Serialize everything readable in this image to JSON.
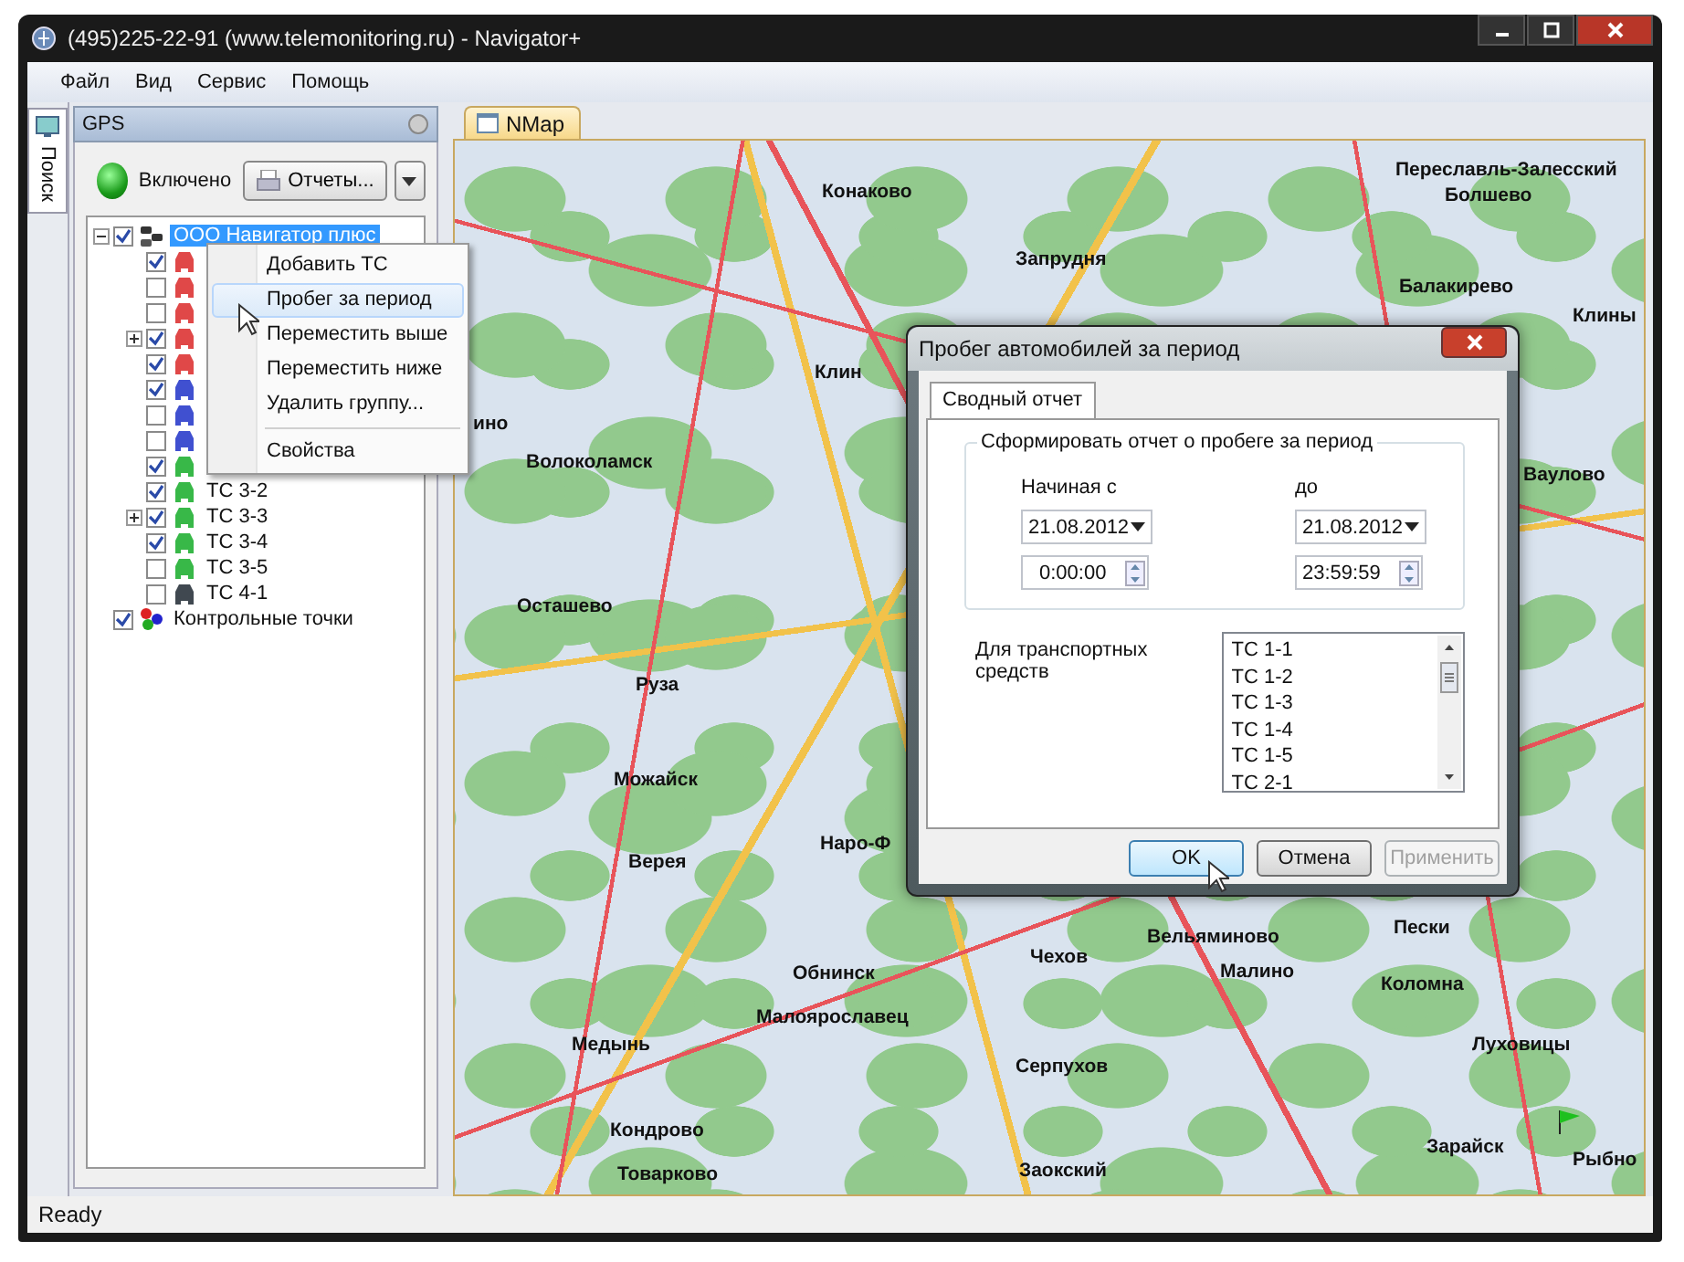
{
  "window": {
    "title": "(495)225-22-91  (www.telemonitoring.ru) - Navigator+"
  },
  "menu": [
    "Файл",
    "Вид",
    "Сервис",
    "Помощь"
  ],
  "side_tab": {
    "label": "Поиск",
    "selected": true
  },
  "gps_panel": {
    "title": "GPS",
    "status": {
      "label": "Включено",
      "on": true
    },
    "reports_button": "Отчеты..."
  },
  "tree": [
    {
      "kind": "group",
      "label": "ООО Навигатор плюс",
      "selected": true,
      "checked": true,
      "expanded": true,
      "children": [
        {
          "kind": "vehicle",
          "checked": true,
          "expandable": false,
          "color": "#e04848"
        },
        {
          "kind": "vehicle",
          "checked": false,
          "expandable": false,
          "color": "#e04848"
        },
        {
          "kind": "vehicle",
          "checked": false,
          "expandable": false,
          "color": "#e04848"
        },
        {
          "kind": "vehicle",
          "checked": true,
          "expandable": true,
          "color": "#e04848"
        },
        {
          "kind": "vehicle",
          "checked": true,
          "expandable": false,
          "color": "#e04848"
        },
        {
          "kind": "vehicle",
          "checked": true,
          "expandable": false,
          "color": "#4050d0"
        },
        {
          "kind": "vehicle",
          "checked": false,
          "expandable": false,
          "color": "#4050d0"
        },
        {
          "kind": "vehicle",
          "checked": false,
          "expandable": false,
          "color": "#4050d0"
        },
        {
          "kind": "vehicle",
          "checked": true,
          "expandable": false,
          "color": "#38b848"
        },
        {
          "kind": "vehicle",
          "label": "ТС 3-2",
          "checked": true,
          "expandable": false,
          "color": "#38b848"
        },
        {
          "kind": "vehicle",
          "label": "ТС 3-3",
          "checked": true,
          "expandable": true,
          "color": "#38b848"
        },
        {
          "kind": "vehicle",
          "label": "ТС 3-4",
          "checked": true,
          "expandable": false,
          "color": "#38b848"
        },
        {
          "kind": "vehicle",
          "label": "ТС 3-5",
          "checked": false,
          "expandable": false,
          "color": "#38b848"
        },
        {
          "kind": "vehicle",
          "label": "ТС 4-1",
          "checked": false,
          "expandable": false,
          "color": "#404850"
        }
      ]
    },
    {
      "kind": "checkpoints",
      "label": "Контрольные точки",
      "selected": false,
      "checked": true
    }
  ],
  "context_menu": [
    {
      "kind": "item",
      "label": "Добавить ТС",
      "selected": false
    },
    {
      "kind": "item",
      "label": "Пробег за период",
      "selected": true
    },
    {
      "kind": "item",
      "label": "Переместить выше",
      "selected": false
    },
    {
      "kind": "item",
      "label": "Переместить ниже",
      "selected": false
    },
    {
      "kind": "item",
      "label": "Удалить группу...",
      "selected": false
    },
    {
      "kind": "separator"
    },
    {
      "kind": "item",
      "label": "Свойства",
      "selected": false
    }
  ],
  "map": {
    "tab": {
      "label": "NMap",
      "selected": true
    },
    "labels": [
      "Конаково",
      "Переславль-Залесский",
      "Болшево",
      "Запрудня",
      "Балакирево",
      "Клины",
      "Клин",
      "ино",
      "Волоколамск",
      "Ваулово",
      "Осташево",
      "Руза",
      "Можайск",
      "Наро-Ф",
      "Верея",
      "Обнинск",
      "Чехов",
      "Вельяминово",
      "Малино",
      "Пески",
      "Коломна",
      "Малоярославец",
      "Медынь",
      "Серпухов",
      "Луховицы",
      "Кондрово",
      "Заокский",
      "Зарайск",
      "Рыбно",
      "Товарково"
    ]
  },
  "dialog": {
    "title": "Пробег автомобилей за период",
    "tabs": [
      {
        "label": "Сводный отчет",
        "selected": true
      }
    ],
    "group_title": "Сформировать отчет о пробеге за период",
    "from_label": "Начиная с",
    "to_label": "до",
    "from_date": "21.08.2012",
    "from_time": "0:00:00",
    "to_date": "21.08.2012",
    "to_time": "23:59:59",
    "vehicles_label": "Для транспортных средств",
    "vehicles": [
      "ТС 1-1",
      "ТС 1-2",
      "ТС 1-3",
      "ТС 1-4",
      "ТС 1-5",
      "ТС 2-1"
    ],
    "buttons": [
      {
        "label": "OK",
        "kind": "default",
        "disabled": false
      },
      {
        "label": "Отмена",
        "kind": "normal",
        "disabled": false
      },
      {
        "label": "Применить",
        "kind": "normal",
        "disabled": true
      }
    ]
  },
  "status_bar": {
    "text": "Ready"
  }
}
